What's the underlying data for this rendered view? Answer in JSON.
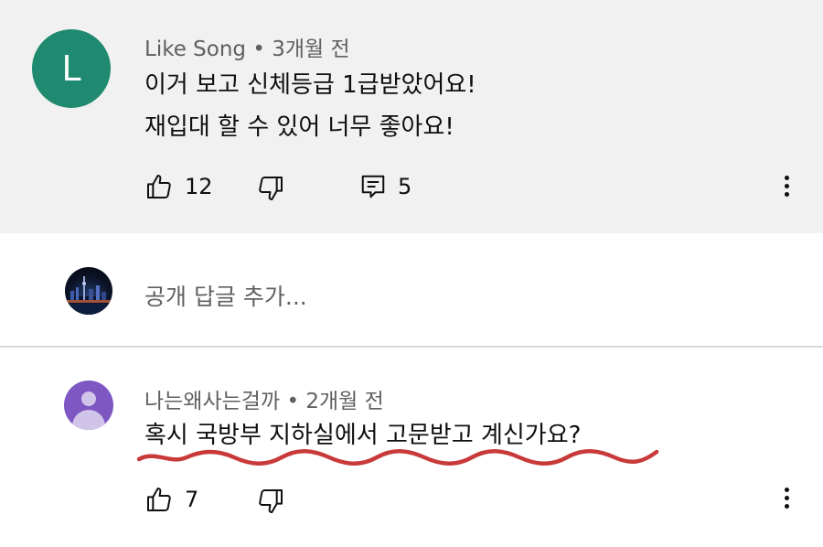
{
  "comment1": {
    "avatar_letter": "L",
    "author": "Like Song",
    "time": "3개월 전",
    "line1": "이거 보고 신체등급 1급받았어요!",
    "line2": "재입대 할 수 있어 너무 좋아요!",
    "likes": "12",
    "replies": "5"
  },
  "reply_box": {
    "placeholder": "공개 답글 추가..."
  },
  "comment2": {
    "author": "나는왜사는걸까",
    "time": "2개월 전",
    "text": "혹시 국방부 지하실에서 고문받고 계신가요?",
    "likes": "7",
    "underline_color": "#c83a3a"
  },
  "colors": {
    "background_top": "#f1f1f1",
    "avatar_l": "#1f8a70",
    "avatar_purple": "#7e57c2"
  },
  "icons": [
    "like-icon",
    "dislike-icon",
    "reply-icon",
    "more-icon",
    "avatar-icon"
  ]
}
